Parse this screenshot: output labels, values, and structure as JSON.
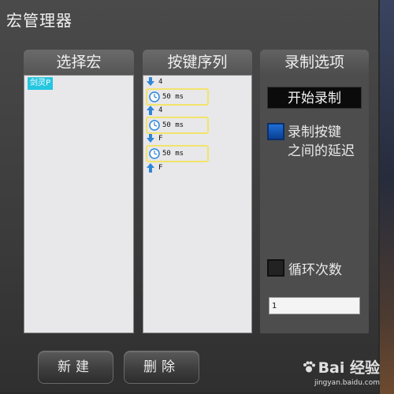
{
  "window": {
    "title": "宏管理器"
  },
  "panels": {
    "select_macro": {
      "header": "选择宏",
      "items": [
        {
          "label": "剑灵P"
        }
      ]
    },
    "key_sequence": {
      "header": "按键序列",
      "rows": [
        {
          "kind": "key",
          "direction": "down",
          "label": "4"
        },
        {
          "kind": "delay",
          "label": "50 ms"
        },
        {
          "kind": "key",
          "direction": "up",
          "label": "4"
        },
        {
          "kind": "delay",
          "label": "50 ms"
        },
        {
          "kind": "key",
          "direction": "down",
          "label": "F"
        },
        {
          "kind": "delay",
          "label": "50 ms"
        },
        {
          "kind": "key",
          "direction": "up",
          "label": "F"
        }
      ]
    },
    "record_options": {
      "header": "录制选项",
      "start_record_label": "开始录制",
      "record_delay_line1": "录制按键",
      "record_delay_line2": "之间的延迟",
      "record_delay_checked": true,
      "loop_label": "循环次数",
      "loop_checked": false,
      "loop_count": "1"
    }
  },
  "buttons": {
    "new_label": "新建",
    "delete_label": "删除"
  },
  "watermark": {
    "brand": "Bai 经验",
    "url": "jingyan.baidu.com"
  },
  "colors": {
    "selection": "#26c6e0",
    "delay_border": "#f2e46a",
    "arrow": "#2f86d6",
    "checkbox_blue": "#1f6fd6"
  }
}
